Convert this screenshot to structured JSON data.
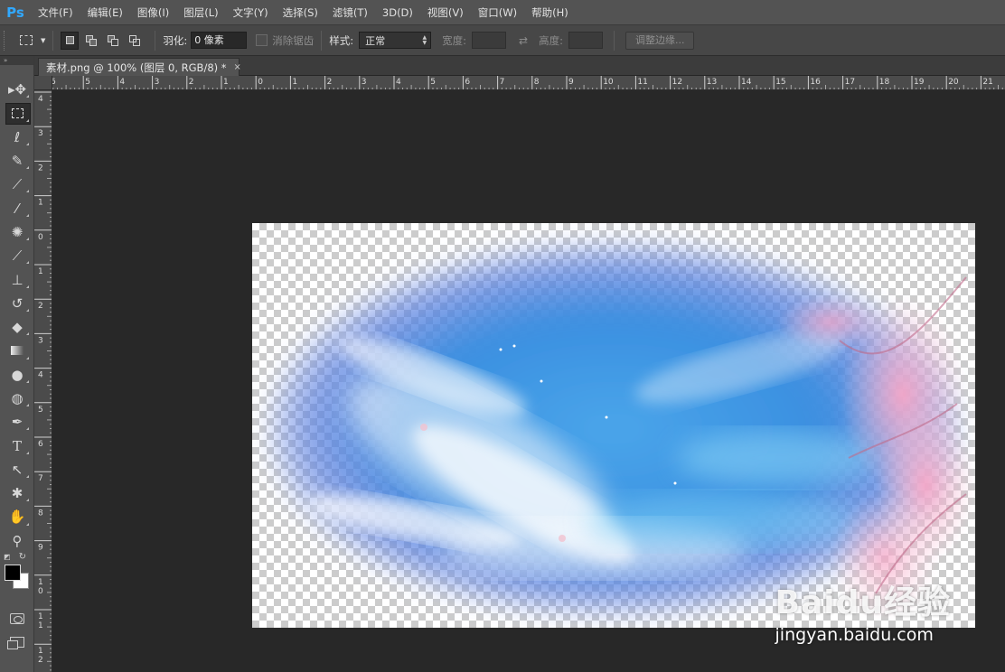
{
  "app": {
    "logo": "Ps"
  },
  "menu": [
    "文件(F)",
    "编辑(E)",
    "图像(I)",
    "图层(L)",
    "文字(Y)",
    "选择(S)",
    "滤镜(T)",
    "3D(D)",
    "视图(V)",
    "窗口(W)",
    "帮助(H)"
  ],
  "options": {
    "feather_label": "羽化:",
    "feather_value": "0 像素",
    "antialias_label": "消除锯齿",
    "style_label": "样式:",
    "style_value": "正常",
    "width_label": "宽度:",
    "height_label": "高度:",
    "refine_button": "调整边缘..."
  },
  "document": {
    "tab_title": "素材.png @ 100% (图层 0, RGB/8) *",
    "close": "×"
  },
  "ruler": {
    "top_labels": [
      "6",
      "5",
      "4",
      "3",
      "2",
      "1",
      "0",
      "1",
      "2",
      "3",
      "4",
      "5",
      "6",
      "7",
      "8",
      "9",
      "10",
      "11",
      "12",
      "13",
      "14",
      "15",
      "16",
      "17",
      "18",
      "19",
      "20",
      "21"
    ],
    "left_labels": [
      "4",
      "3",
      "2",
      "1",
      "0",
      "1",
      "2",
      "3",
      "4",
      "5",
      "6",
      "7",
      "8",
      "9",
      "1\n0",
      "1\n1",
      "1\n2"
    ]
  },
  "toolbar": {
    "tools": [
      "move-tool",
      "marquee-tool",
      "lasso-tool",
      "quick-selection-tool",
      "crop-tool",
      "eyedropper-tool",
      "spot-healing-tool",
      "brush-tool",
      "clone-stamp-tool",
      "history-brush-tool",
      "eraser-tool",
      "gradient-tool",
      "blur-tool",
      "dodge-tool",
      "pen-tool",
      "type-tool",
      "path-selection-tool",
      "shape-tool",
      "hand-tool",
      "zoom-tool"
    ],
    "active": "marquee-tool",
    "foreground_color": "#000000",
    "background_color": "#ffffff"
  },
  "canvas": {
    "background": "#282828",
    "image_content": "sky-with-clouds-and-cherry-blossoms"
  },
  "watermark": {
    "brand": "Baidu经验",
    "url": "jingyan.baidu.com"
  }
}
